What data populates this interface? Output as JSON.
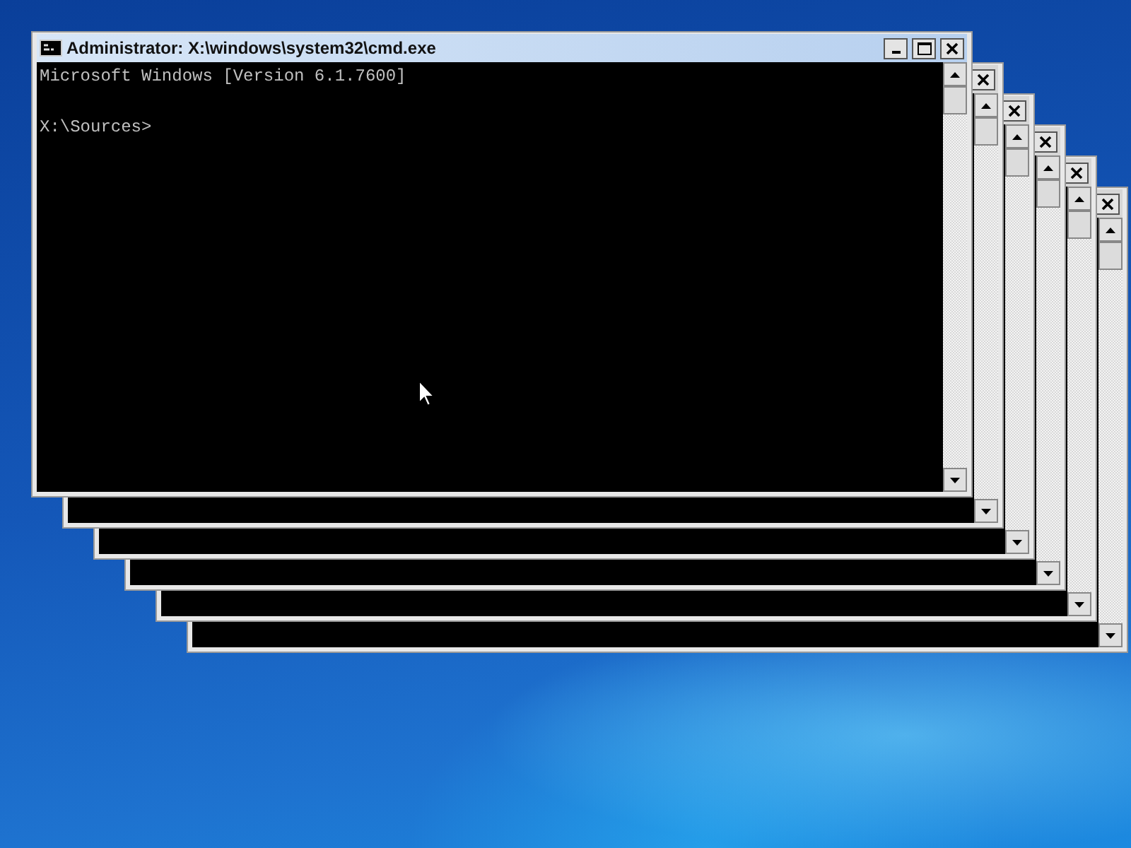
{
  "windows": [
    {
      "active": true,
      "title": "Administrator: X:\\windows\\system32\\cmd.exe",
      "lines": [
        "Microsoft Windows [Version 6.1.7600]",
        "X:\\Sources>"
      ]
    },
    {
      "active": false
    },
    {
      "active": false
    },
    {
      "active": false
    },
    {
      "active": false
    },
    {
      "active": false
    }
  ]
}
